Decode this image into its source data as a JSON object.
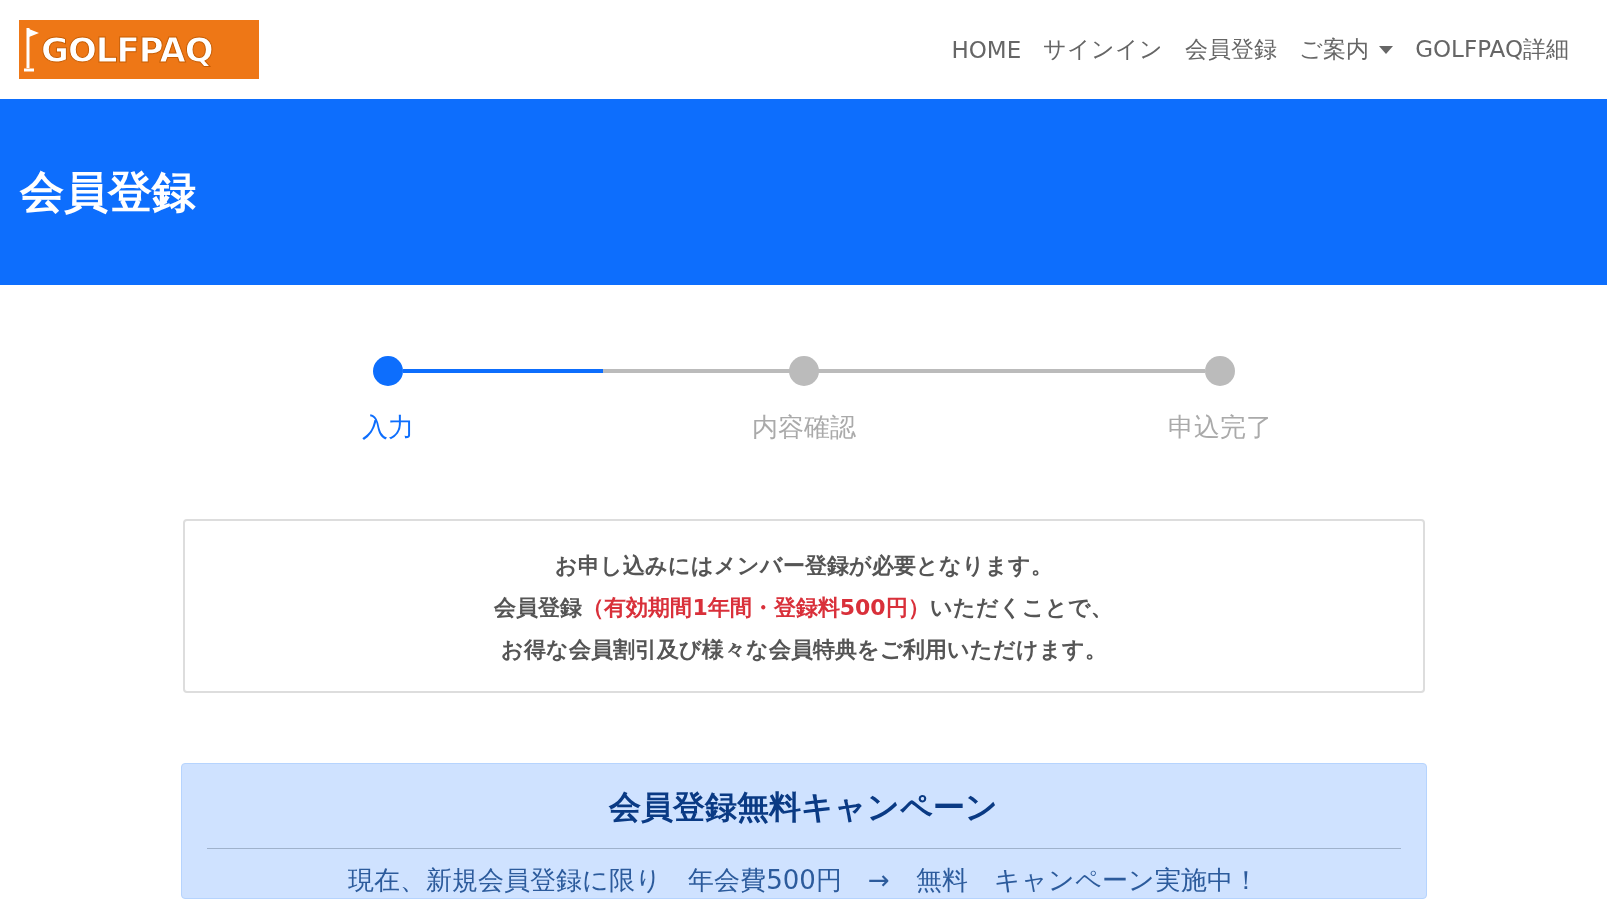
{
  "header": {
    "logo": "GOLFPAQ",
    "nav": [
      {
        "label": "HOME",
        "dropdown": false
      },
      {
        "label": "サインイン",
        "dropdown": false
      },
      {
        "label": "会員登録",
        "dropdown": false
      },
      {
        "label": "ご案内",
        "dropdown": true
      },
      {
        "label": "GOLFPAQ詳細",
        "dropdown": false
      }
    ]
  },
  "banner": {
    "title": "会員登録"
  },
  "stepper": {
    "level": 0.25,
    "steps": [
      {
        "label": "入力",
        "selected": true
      },
      {
        "label": "内容確認",
        "selected": false
      },
      {
        "label": "申込完了",
        "selected": false
      }
    ]
  },
  "notice": {
    "lines": [
      "お申し込みにはメンバー登録が必要となります。",
      "会員登録**（有効期間1年間・登録料500円）**いただくことで、",
      "お得な会員割引及び様々な会員特典をご利用いただけます。"
    ]
  },
  "campaign": {
    "title": "会員登録無料キャンペーン",
    "text": "現在、新規会員登録に限り　年会費500円　→　無料　キャンペーン実施中！"
  }
}
